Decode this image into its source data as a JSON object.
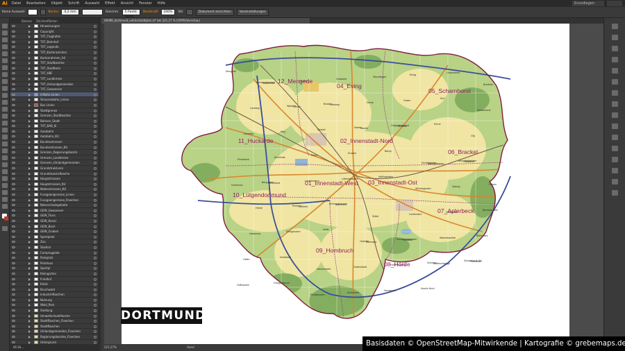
{
  "app": {
    "logo": "Ai",
    "workspace": "Grundlagen"
  },
  "menu": [
    "Datei",
    "Bearbeiten",
    "Objekt",
    "Schrift",
    "Auswahl",
    "Effekt",
    "Ansicht",
    "Fenster",
    "Hilfe"
  ],
  "control_bar": {
    "selection": "Keine Auswahl",
    "stroke_label": "Kontur",
    "stroke_value": "0,2 mm",
    "profile": "Gleichm.",
    "brush": "5 Punkt Rund",
    "opacity_label": "Deckkraft",
    "opacity_value": "100%",
    "style_label": "Stil",
    "doc_setup": "Dokument einrichten",
    "preferences": "Voreinstellungen"
  },
  "panel": {
    "tabs": [
      "Ebenen",
      "Zeichenflächen"
    ],
    "footer": "66 Eb..."
  },
  "layers": [
    "Hinweisungen",
    "Copyright",
    "TXT_Flughafen",
    "TXT_Bahnhof",
    "TXT_Legende",
    "TXT_Kartenzeichen",
    "Kartenrahmen_A4",
    "TXT_Stadtbezirke",
    "TXT_Stadtteile",
    "TXT_HBF",
    "TXT_Landkreise",
    "TXT_Umlandgemeinden",
    "TXT_Gewaesser",
    "U-Bahn Linien",
    "Strassenbahn_Linien",
    "Bus Linien",
    "Stadtgrenze",
    "Grenzen_Stadtbezirke",
    "Bahnen_Stadt",
    "TXT_BAB_IE",
    "Autobahn",
    "Autobahn_KU",
    "Bundesstrassen",
    "Bundesstrassen_KU",
    "Grenzen_Regierungsbezirk",
    "Grenzen_Landkreise",
    "Grenzen_Umlandgemeinden",
    "Grundstrukturen",
    "Grundstuecksflaeche",
    "Hauptstrassen",
    "Hauptstrassen_KU",
    "Nebenstrassen_KU",
    "Fussgaengerzone_Linien",
    "Fussgaengerzone_Flaechen",
    "Naturschutzgebiete",
    "GEW_Gewaesser",
    "GEW_Fluss",
    "GEW_Kanal",
    "GEW_Bach",
    "GEW_Graben",
    "Sportplatz",
    "Zoo",
    "Stadion",
    "Campingplatz",
    "Parkplatz",
    "Parkhaus",
    "Sportpl",
    "Kleingarten",
    "Friedhof",
    "Klinik",
    "Bruchwald",
    "Industrieflaechen",
    "Nutzung",
    "Wald_Park",
    "Siedlung",
    "Umweltschutzflaeche",
    "Stadtflaechen_Flaechen",
    "Stadtflaechen",
    "Umlandgemeinden_Flaechen",
    "Regierungsbezirke_Flaechen",
    "Untergrund"
  ],
  "selected_layer_index": 13,
  "document_tab": "00089_dortmund_vektorstadtplan.ai* bei 221,27 % (CMYK/Vorschau)",
  "status": {
    "zoom": "221,27%",
    "tool": "Hand"
  },
  "map": {
    "city": "DORTMUND",
    "credit": "Basisdaten © OpenStreetMap-Mitwirkende | Kartografie © grebemaps.de",
    "districts": [
      "12_Mengede",
      "04_Eving",
      "05_Scharnhorst",
      "11_Huckarde",
      "02_Innenstadt-Nord",
      "06_Brackel",
      "01_Innenstadt-West",
      "03_Innenstadt-Ost",
      "10_Lütgendortmund",
      "07_Aplerbeck",
      "09_Hombruch",
      "08_Hörde"
    ],
    "places": [
      "Mengede",
      "Westerfilde",
      "Deusen",
      "Huckarde",
      "Wischlingen",
      "Eving",
      "Lindenhorst",
      "Brechten",
      "Kemminghausen",
      "Grevel",
      "Lanstrop",
      "Derne",
      "Husen",
      "Kurl",
      "Scharnhorst",
      "Lanstrup",
      "Wambel",
      "Brackel",
      "Asseln",
      "Wickede",
      "Körne",
      "City",
      "Dorstfeld",
      "Kley",
      "Oespel",
      "Marten",
      "Lütgendortmund",
      "Bövinghausen",
      "Westrich",
      "Persebeck",
      "Kirchlinde",
      "Rahm",
      "Kruckel",
      "Barop",
      "Eichlinghofen",
      "Menglinghausen",
      "Hombruch",
      "Kirchhörde",
      "Lücklemberg",
      "Löttringhausen",
      "Wellinghofen",
      "Wichlinghofen",
      "Syburg",
      "Holzen",
      "Berghofen",
      "Schüren",
      "Aplerbeck",
      "Sölde",
      "Lichtendorf",
      "Sölderholz",
      "Benninghofen",
      "Hörde",
      "Phoenix",
      "Brünninghausen",
      "Kemnade",
      "Schönau",
      "Wannebachtal",
      "Bittermark",
      "Hacheney",
      "Ellinghausen",
      "Nette",
      "Oestrich",
      "Schwieringhausen",
      "Bodelschwingh",
      "Rahmede",
      "Hafen",
      "Nordstadt",
      "Kaiserstraße",
      "Gartenstadt",
      "Hohenbuschei",
      "Schönau",
      "Scharnhorst Ost",
      "Holthausen",
      "Groppenbruch",
      "Ellinghausen",
      "Kirchderne",
      "Neuasseln",
      "Asseln Nord"
    ]
  },
  "colors": {
    "accent": "#ff9a00",
    "chrome_dark": "#2a2a2a",
    "chrome": "#3a3a3a",
    "selected_layer": "#4f5a72",
    "map_urban": "#f0e5a2",
    "map_green": "#b8d286",
    "map_forest": "#84ae5f",
    "map_boundary": "#7e1c3d",
    "map_motorway": "#3a4e9a",
    "map_mainroad": "#d8862e",
    "map_water": "#8fb6d4"
  }
}
